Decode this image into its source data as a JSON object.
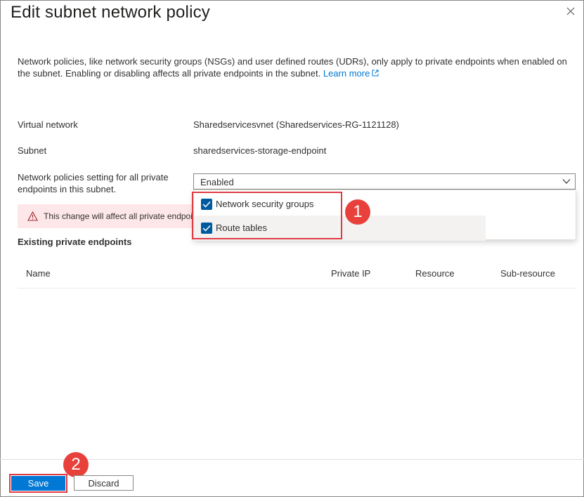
{
  "panel": {
    "title": "Edit subnet network policy",
    "description": "Network policies, like network security groups (NSGs) and user defined routes (UDRs), only apply to private endpoints when enabled on the subnet. Enabling or disabling affects all private endpoints in the subnet.",
    "learn_more": "Learn more",
    "close_icon": "close-icon"
  },
  "fields": {
    "virtual_network_label": "Virtual network",
    "virtual_network_value": "Sharedservicesvnet (Sharedservices-RG-1121128)",
    "subnet_label": "Subnet",
    "subnet_value": "sharedservices-storage-endpoint",
    "policies_label": "Network policies setting for all private endpoints in this subnet.",
    "policies_value": "Enabled"
  },
  "dropdown": {
    "options": [
      {
        "label": "Network security groups",
        "checked": true
      },
      {
        "label": "Route tables",
        "checked": true
      }
    ]
  },
  "warning": {
    "icon": "warning-triangle-icon",
    "text": "This change will affect all private endpoints in this subnet."
  },
  "endpoints": {
    "section_title": "Existing private endpoints",
    "columns": [
      "Name",
      "Private IP",
      "Resource",
      "Sub-resource"
    ]
  },
  "annotations": {
    "step1": "1",
    "step2": "2"
  },
  "footer": {
    "save_label": "Save",
    "discard_label": "Discard"
  },
  "colors": {
    "accent": "#0078d4",
    "highlight": "#e03b45",
    "warning_bg": "#fde7e9"
  }
}
